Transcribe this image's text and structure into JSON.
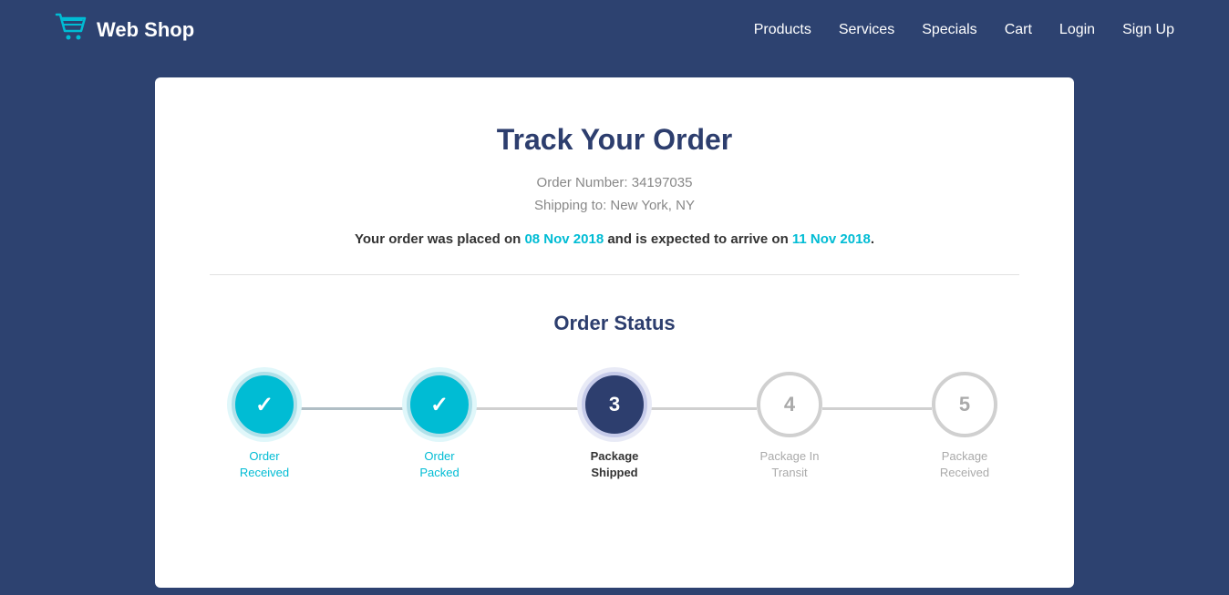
{
  "header": {
    "logo_text": "Web Shop",
    "logo_icon": "🛒",
    "nav": {
      "products": "Products",
      "services": "Services",
      "specials": "Specials",
      "cart": "Cart",
      "login": "Login",
      "signup": "Sign Up"
    }
  },
  "main": {
    "title": "Track Your Order",
    "order_number_label": "Order Number: 34197035",
    "shipping_label": "Shipping to: New York, NY",
    "message_prefix": "Your order was placed on ",
    "placed_date": "08 Nov 2018",
    "message_middle": " and is expected to arrive on ",
    "arrive_date": "11 Nov 2018",
    "message_suffix": ".",
    "order_status_title": "Order Status",
    "steps": [
      {
        "id": 1,
        "state": "completed",
        "label_line1": "Order",
        "label_line2": "Received",
        "display": "✓"
      },
      {
        "id": 2,
        "state": "completed",
        "label_line1": "Order",
        "label_line2": "Packed",
        "display": "✓"
      },
      {
        "id": 3,
        "state": "active",
        "label_line1": "Package",
        "label_line2": "Shipped",
        "display": "3"
      },
      {
        "id": 4,
        "state": "inactive",
        "label_line1": "Package In",
        "label_line2": "Transit",
        "display": "4"
      },
      {
        "id": 5,
        "state": "inactive",
        "label_line1": "Package",
        "label_line2": "Received",
        "display": "5"
      }
    ]
  }
}
